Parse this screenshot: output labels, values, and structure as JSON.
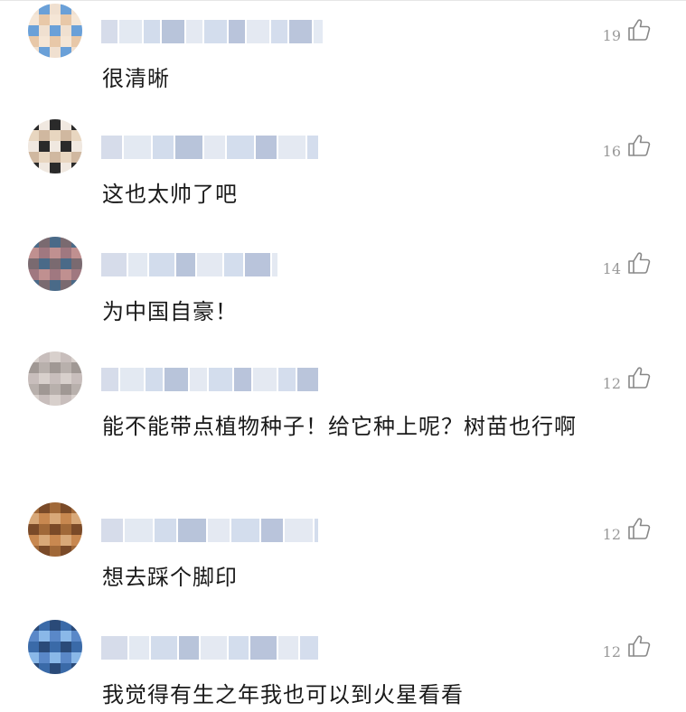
{
  "comments": [
    {
      "likes": "19",
      "text": "很清晰",
      "avatar_colors": [
        "#f0e0d0",
        "#e8c8a8",
        "#6aa0d8",
        "#f5e6d6"
      ]
    },
    {
      "likes": "16",
      "text": "这也太帅了吧",
      "avatar_colors": [
        "#e8d6c0",
        "#2a2a2a",
        "#d0b8a0",
        "#f0e8e0"
      ]
    },
    {
      "likes": "14",
      "text": "为中国自豪！",
      "avatar_colors": [
        "#7a6a70",
        "#c09090",
        "#4a6a88",
        "#a07880"
      ]
    },
    {
      "likes": "12",
      "text": "能不能带点植物种子！给它种上呢？树苗也行啊",
      "avatar_colors": [
        "#b8b0ac",
        "#c8bebc",
        "#a09894",
        "#d8d0cc"
      ]
    },
    {
      "likes": "12",
      "text": "想去踩个脚印",
      "avatar_colors": [
        "#a06838",
        "#c88850",
        "#7a4a28",
        "#d8a878"
      ]
    },
    {
      "likes": "12",
      "text": "我觉得有生之年我也可以到火星看看",
      "avatar_colors": [
        "#5a88c8",
        "#2a4a78",
        "#8ab8e8",
        "#3a6aa8"
      ]
    }
  ],
  "icons": {
    "like": "thumbs-up-icon"
  },
  "colors": {
    "text": "#1a1a1a",
    "muted": "#999999",
    "blur": "#c8d4e8"
  }
}
